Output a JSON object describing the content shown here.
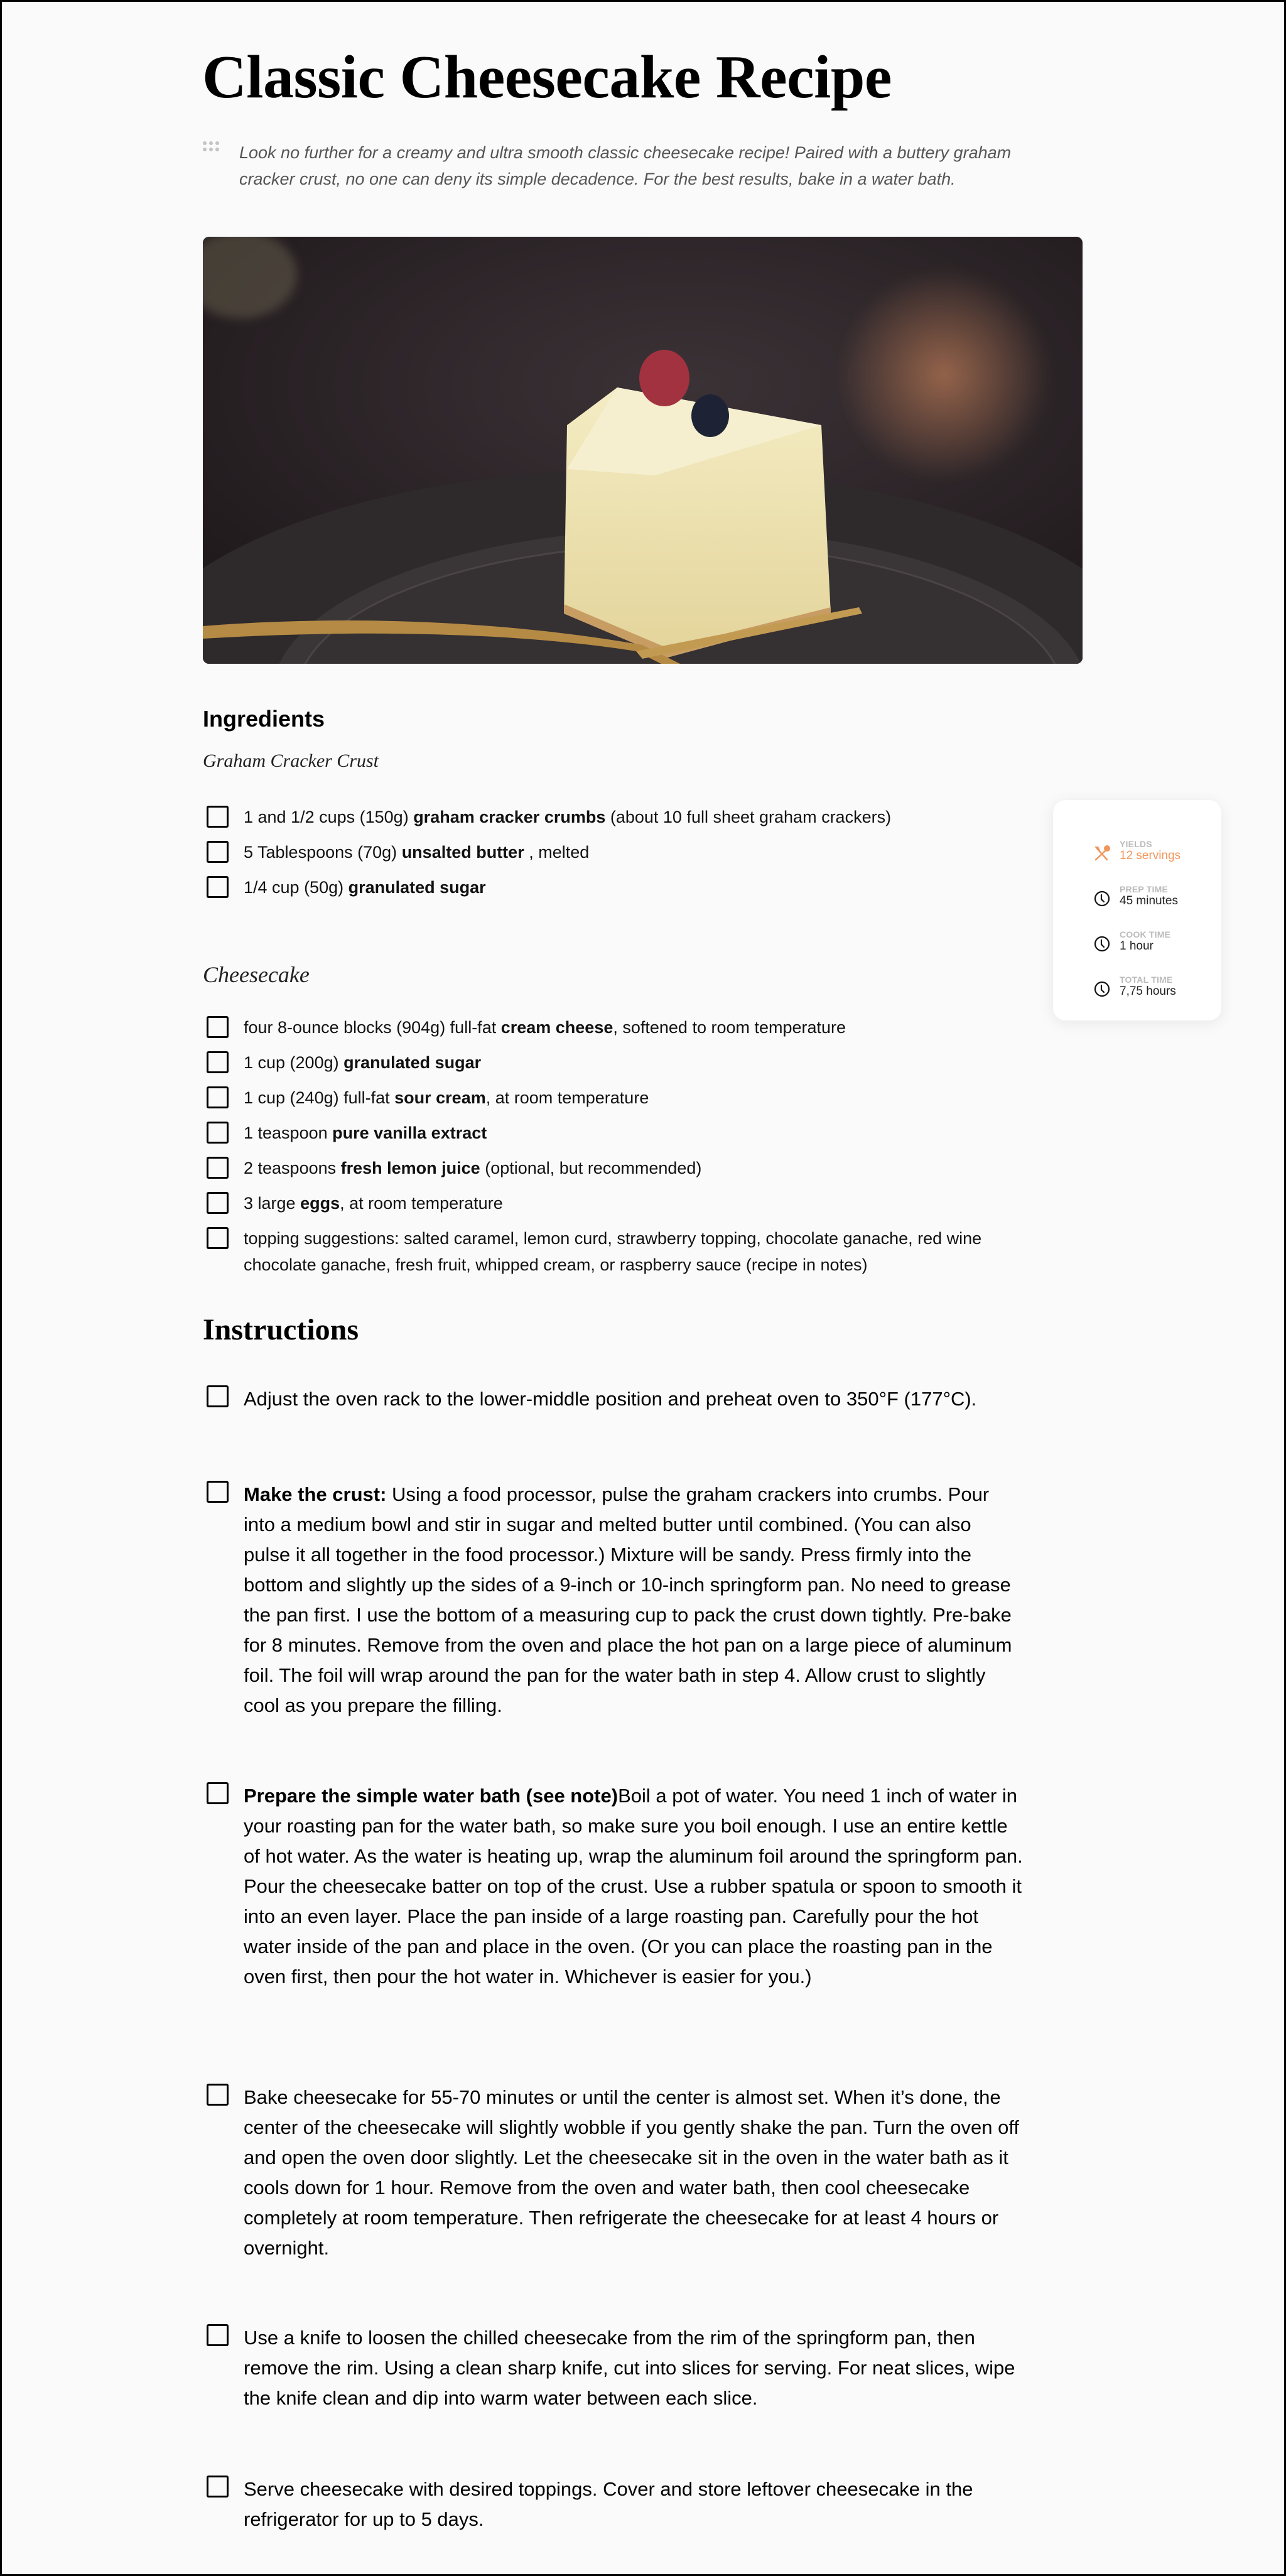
{
  "title": "Classic Cheesecake Recipe",
  "intro": "Look no further for a creamy and ultra smooth classic cheesecake recipe! Paired with a buttery graham cracker crust, no one can deny its simple decadence. For the best results, bake in a water bath.",
  "hero_image": {
    "alt": "Slice of classic cheesecake topped with a raspberry and blueberry on a dark plate with a gold fork",
    "icon": "photo"
  },
  "ingredients": {
    "heading": "Ingredients",
    "groups": [
      {
        "name": "Graham Cracker Crust",
        "items": [
          {
            "pre": "1 and 1/2 cups (150g) ",
            "bold": "graham cracker crumbs",
            "post": " (about 10 full sheet graham crackers)"
          },
          {
            "pre": "5 Tablespoons (70g) ",
            "bold": "unsalted butter",
            "post": " , melted"
          },
          {
            "pre": "1/4 cup (50g) ",
            "bold": "granulated sugar",
            "post": ""
          }
        ]
      },
      {
        "name": "Cheesecake",
        "items": [
          {
            "pre": "four 8-ounce blocks (904g) full-fat ",
            "bold": "cream cheese",
            "post": ", softened to room temperature"
          },
          {
            "pre": "1 cup (200g) ",
            "bold": "granulated sugar",
            "post": ""
          },
          {
            "pre": "1 cup (240g) full-fat ",
            "bold": "sour cream",
            "post": ", at room temperature"
          },
          {
            "pre": "1 teaspoon ",
            "bold": "pure vanilla extract",
            "post": ""
          },
          {
            "pre": "2 teaspoons ",
            "bold": "fresh lemon juice",
            "post": " (optional, but recommended)"
          },
          {
            "pre": "3 large ",
            "bold": "eggs",
            "post": ", at room temperature"
          },
          {
            "pre": "topping suggestions: salted caramel, lemon curd, strawberry topping, chocolate ganache, red wine chocolate ganache, fresh fruit, whipped cream, or raspberry sauce (recipe in notes)",
            "bold": "",
            "post": ""
          }
        ]
      }
    ]
  },
  "instructions": {
    "heading": "Instructions",
    "steps": [
      {
        "bold": "",
        "text": "Adjust the oven rack to the lower-middle position and preheat oven to 350°F (177°C)."
      },
      {
        "bold": "Make the crust:",
        "text": " Using a food processor, pulse the graham crackers into crumbs. Pour into a medium bowl and stir in sugar and melted butter until combined. (You can also pulse it all together in the food processor.) Mixture will be sandy. Press firmly into the bottom and slightly up the sides of a 9-inch or 10-inch springform pan. No need to grease the pan first. I use the bottom of a measuring cup to pack the crust down tightly. Pre-bake for 8 minutes. Remove from the oven and place the hot pan on a large piece of aluminum foil. The foil will wrap around the pan for the water bath in step 4. Allow crust to slightly cool as you prepare the filling."
      },
      {
        "bold": "Prepare the simple water bath (see note)",
        "text": "Boil a pot of water. You need 1 inch of water in your roasting pan for the water bath, so make sure you boil enough. I use an entire kettle of hot water. As the water is heating up, wrap the aluminum foil around the springform pan. Pour the cheesecake batter on top of the crust. Use a rubber spatula or spoon to smooth it into an even layer. Place the pan inside of a large roasting pan. Carefully pour the hot water inside of the pan and place in the oven. (Or you can place the roasting pan in the oven first, then pour the hot water in. Whichever is easier for you.)"
      },
      {
        "bold": "",
        "text": "Bake cheesecake for 55-70 minutes or until the center is almost set. When it’s done, the center of the cheesecake will slightly wobble if you gently shake the pan. Turn the oven off and open the oven door slightly. Let the cheesecake sit in the oven in the water bath as it cools down for 1 hour. Remove from the oven and water bath, then cool cheesecake completely at room temperature. Then refrigerate the cheesecake for at least 4 hours or overnight."
      },
      {
        "bold": "",
        "text": "Use a knife to loosen the chilled cheesecake from the rim of the springform pan, then remove the rim. Using a clean sharp knife, cut into slices for serving. For neat slices, wipe the knife clean and dip into warm water between each slice."
      },
      {
        "bold": "",
        "text": "Serve cheesecake with desired toppings. Cover and store leftover cheesecake in the refrigerator for up to 5 days."
      }
    ]
  },
  "meta": {
    "yields": {
      "label": "YIELDS",
      "value": "12 servings",
      "icon": "utensils-icon"
    },
    "prep": {
      "label": "PREP TIME",
      "value": "45 minutes",
      "icon": "clock-icon"
    },
    "cook": {
      "label": "COOK TIME",
      "value": "1 hour",
      "icon": "clock-icon"
    },
    "total": {
      "label": "TOTAL TIME",
      "value": "7,75 hours",
      "icon": "clock-icon"
    }
  },
  "colors": {
    "accent": "#f0965b",
    "background": "#fafafa",
    "muted_label": "#bbbbbb"
  }
}
